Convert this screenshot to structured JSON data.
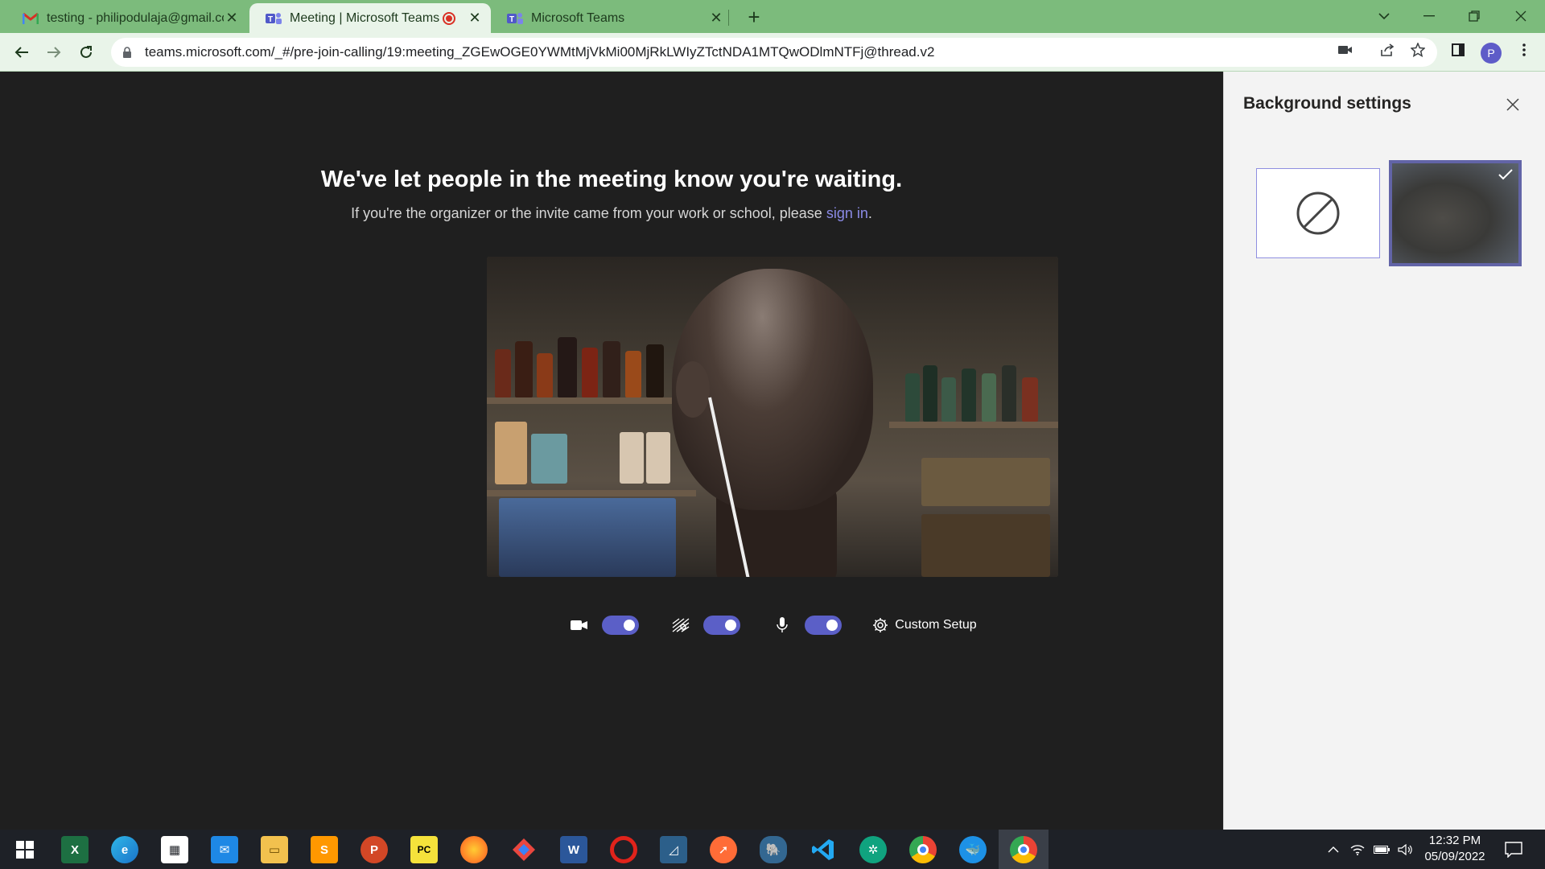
{
  "browser": {
    "tabs": [
      {
        "title": "testing - philipodulaja@gmail.co",
        "favicon": "gmail-icon",
        "active": false
      },
      {
        "title": "Meeting | Microsoft Teams",
        "favicon": "teams-icon",
        "active": true,
        "recording": true
      },
      {
        "title": "Microsoft Teams",
        "favicon": "teams-icon",
        "active": false
      }
    ],
    "url": "teams.microsoft.com/_#/pre-join-calling/19:meeting_ZGEwOGE0YWMtMjVkMi00MjRkLWIyZTctNDA1MTQwODlmNTFj@thread.v2",
    "profile_initial": "P"
  },
  "meeting": {
    "heading": "We've let people in the meeting know you're waiting.",
    "subtext": "If you're the organizer or the invite came from your work or school, please ",
    "signin_link": "sign in",
    "subtext_end": ".",
    "controls": {
      "camera_on": true,
      "blur_on": true,
      "mic_on": true,
      "custom_setup_label": "Custom Setup"
    }
  },
  "background_panel": {
    "title": "Background settings",
    "options": [
      {
        "name": "none",
        "selected": false
      },
      {
        "name": "blur",
        "selected": true
      }
    ]
  },
  "taskbar": {
    "apps": [
      "windows-start-icon",
      "excel-icon",
      "edge-icon",
      "store-icon",
      "mail-icon",
      "file-explorer-icon",
      "sublime-icon",
      "powerpoint-icon",
      "pycharm-icon",
      "firefox-icon",
      "git-icon",
      "word-icon",
      "opera-icon",
      "mysql-workbench-icon",
      "postman-icon",
      "postgresql-icon",
      "vscode-icon",
      "chatgpt-icon",
      "chrome-icon",
      "docker-icon",
      "chrome-profile-icon"
    ],
    "time": "12:32 PM",
    "date": "05/09/2022"
  },
  "colors": {
    "accent": "#5b5fc7",
    "chrome_frame": "#7cbb7c",
    "meeting_bg": "#1f1f1f"
  }
}
